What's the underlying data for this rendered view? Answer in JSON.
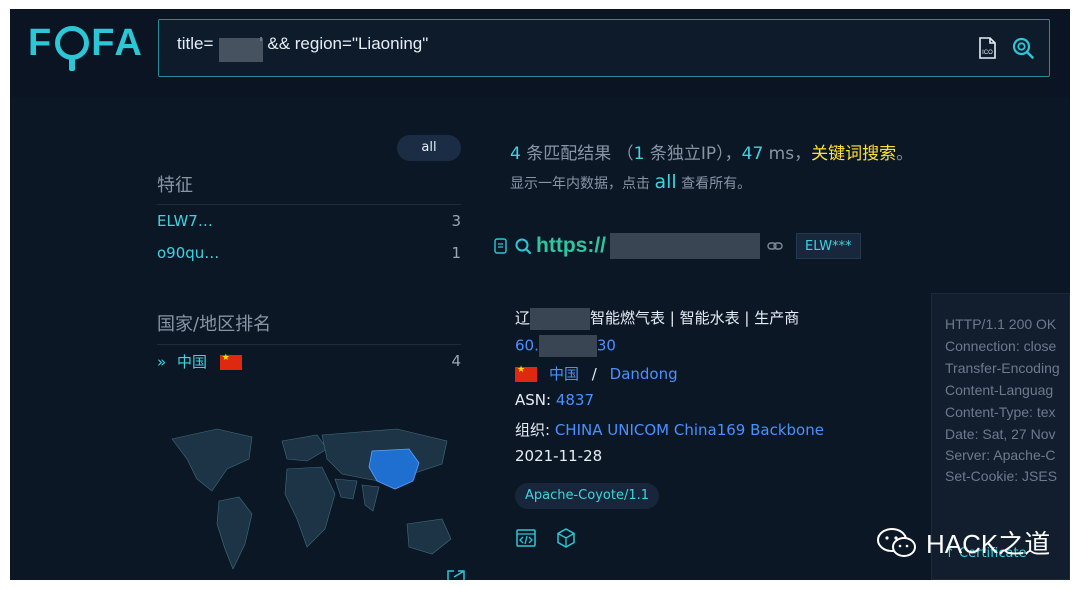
{
  "app": {
    "logo": "FOFA"
  },
  "search": {
    "query_prefix": "title=",
    "query_suffix": "' && region=\"Liaoning\""
  },
  "sidebar": {
    "all_pill": "all",
    "features_title": "特征",
    "features": [
      {
        "name": "ELW7…",
        "count": "3"
      },
      {
        "name": "o90qu…",
        "count": "1"
      }
    ],
    "country_title": "国家/地区排名",
    "countries": [
      {
        "name": "中国",
        "count": "4"
      }
    ]
  },
  "results": {
    "count": "4",
    "count_label": " 条匹配结果 （",
    "unique_ip": "1",
    "unique_ip_label": " 条独立IP），",
    "ms": "47",
    "ms_label": " ms，",
    "keyword_search": "关键词搜索",
    "keyword_suffix": "。",
    "sub_prefix": "显示一年内数据，点击 ",
    "sub_all": "all",
    "sub_suffix": " 查看所有。"
  },
  "result_item": {
    "url_prefix": "https://",
    "tag": "ELW***",
    "title_prefix": "辽",
    "title_suffix": "智能燃气表 | 智能水表 | 生产商",
    "ip_prefix": "60.",
    "ip_suffix": "30",
    "country": "中国",
    "separator": "/",
    "city": "Dandong",
    "asn_label": "ASN: ",
    "asn": "4837",
    "org_label": "组织: ",
    "org": "CHINA UNICOM China169 Backbone",
    "date": "2021-11-28",
    "server_tag": "Apache-Coyote/1.1"
  },
  "http_headers": [
    "HTTP/1.1 200 OK",
    "Connection: close",
    "Transfer-Encoding",
    "Content-Languag",
    "Content-Type: tex",
    "Date: Sat, 27 Nov",
    "Server: Apache-C",
    "Set-Cookie: JSES"
  ],
  "http_footer": "Certificate",
  "watermark": "HACK之道",
  "colors": {
    "bg": "#0c1726",
    "accent": "#2dc6d6",
    "link": "#4a90ff",
    "keyword": "#ffe033",
    "muted": "#8795a6"
  }
}
